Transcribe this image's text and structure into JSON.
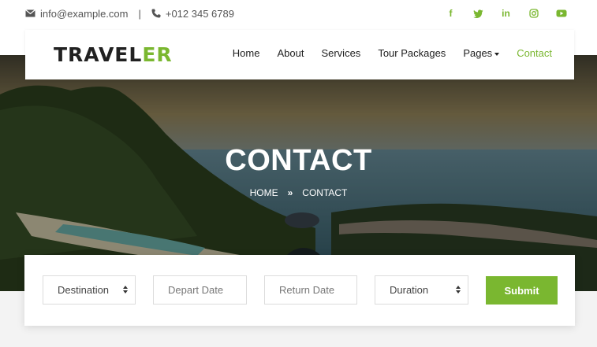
{
  "topbar": {
    "email": "info@example.com",
    "separator": "|",
    "phone": "+012 345 6789",
    "social": [
      {
        "icon": "facebook-icon",
        "glyph": "f"
      },
      {
        "icon": "twitter-icon",
        "glyph": "t"
      },
      {
        "icon": "linkedin-icon",
        "glyph": "in"
      },
      {
        "icon": "instagram-icon",
        "glyph": "◎"
      },
      {
        "icon": "youtube-icon",
        "glyph": "▶"
      }
    ]
  },
  "navbar": {
    "brand_main": "TRAVEL",
    "brand_accent": "ER",
    "links": [
      "Home",
      "About",
      "Services",
      "Tour Packages",
      "Pages",
      "Contact"
    ],
    "active": "Contact"
  },
  "hero": {
    "title": "CONTACT",
    "breadcrumb_home": "HOME",
    "breadcrumb_sep": "»",
    "breadcrumb_current": "CONTACT"
  },
  "booking": {
    "destination": "Destination",
    "depart_placeholder": "Depart Date",
    "return_placeholder": "Return Date",
    "duration": "Duration",
    "submit": "Submit"
  },
  "colors": {
    "accent": "#7ab730",
    "text": "#212121"
  }
}
